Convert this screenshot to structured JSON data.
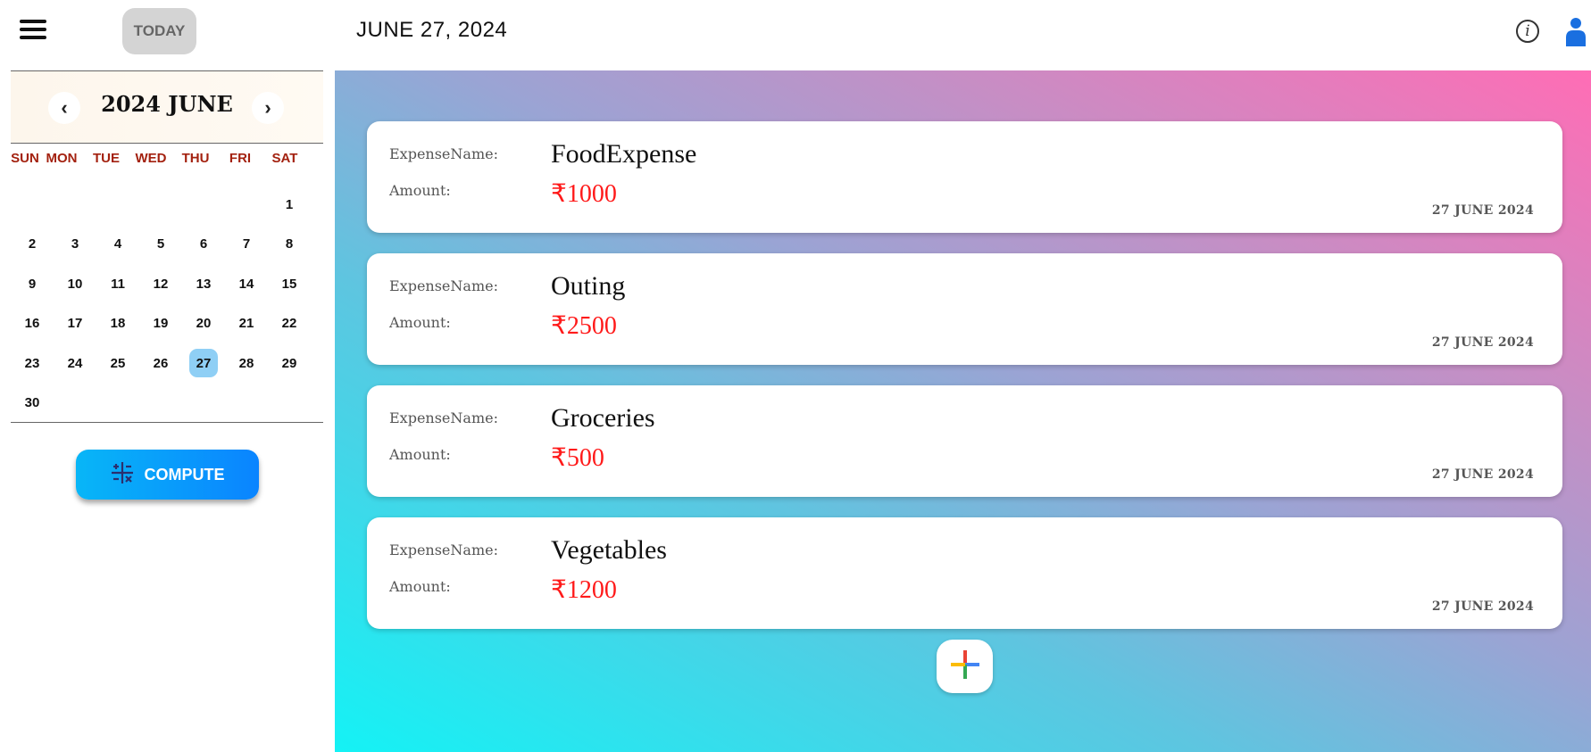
{
  "header": {
    "today_label": "TODAY",
    "date_label": "JUNE 27, 2024",
    "info_icon": "info-icon",
    "user_icon": "user-icon",
    "menu_icon": "hamburger-menu-icon"
  },
  "calendar": {
    "title": "2024 JUNE",
    "prev_icon": "chevron-left-icon",
    "next_icon": "chevron-right-icon",
    "prev_glyph": "‹",
    "next_glyph": "›",
    "weekdays": [
      "SUN",
      "MON",
      "TUE",
      "WED",
      "THU",
      "FRI",
      "SAT"
    ],
    "days": [
      "1",
      "2",
      "3",
      "4",
      "5",
      "6",
      "7",
      "8",
      "9",
      "10",
      "11",
      "12",
      "13",
      "14",
      "15",
      "16",
      "17",
      "18",
      "19",
      "20",
      "21",
      "22",
      "23",
      "24",
      "25",
      "26",
      "27",
      "28",
      "29",
      "30"
    ],
    "selected_day": "27",
    "first_weekday": "SAT",
    "colors": {
      "weekday": "#a3210f",
      "selected": "#8fcff5"
    }
  },
  "compute": {
    "label": "COMPUTE",
    "icon": "calculator-icon"
  },
  "expenses": [
    {
      "name_label": "ExpenseName:",
      "name": "FoodExpense",
      "amount_label": "Amount:",
      "amount": "₹1000",
      "date": "27 JUNE 2024"
    },
    {
      "name_label": "ExpenseName:",
      "name": "Outing",
      "amount_label": "Amount:",
      "amount": "₹2500",
      "date": "27 JUNE 2024"
    },
    {
      "name_label": "ExpenseName:",
      "name": "Groceries",
      "amount_label": "Amount:",
      "amount": "₹500",
      "date": "27 JUNE 2024"
    },
    {
      "name_label": "ExpenseName:",
      "name": "Vegetables",
      "amount_label": "Amount:",
      "amount": "₹1200",
      "date": "27 JUNE 2024"
    }
  ],
  "add_button": {
    "icon": "plus-icon"
  },
  "colors": {
    "amount": "#ff1a1a",
    "compute_gradient": [
      "#08b6f7",
      "#0a84ff"
    ],
    "background_gradient": [
      "#14f2f5",
      "#ff6db5"
    ]
  }
}
